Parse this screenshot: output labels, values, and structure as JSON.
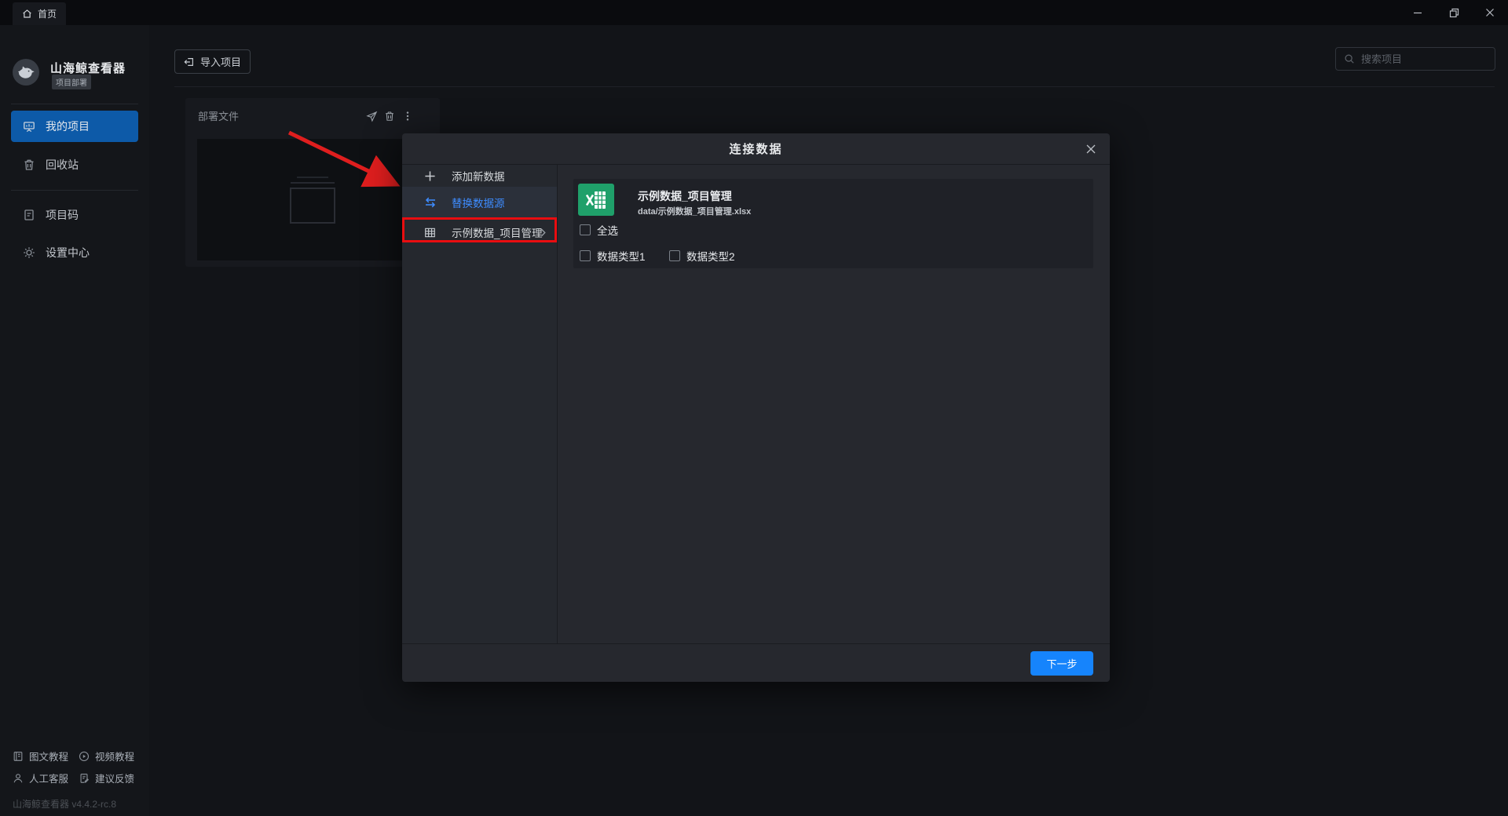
{
  "titlebar": {
    "tab_label": "首页"
  },
  "sidebar": {
    "app_name": "山海鲸查看器",
    "badge": "项目部署",
    "items": [
      {
        "label": "我的项目",
        "active": true
      },
      {
        "label": "回收站",
        "active": false
      },
      {
        "label": "项目码",
        "active": false
      },
      {
        "label": "设置中心",
        "active": false
      }
    ],
    "footer_links": [
      {
        "label": "图文教程"
      },
      {
        "label": "视频教程"
      },
      {
        "label": "人工客服"
      },
      {
        "label": "建议反馈"
      }
    ],
    "version": "山海鲸查看器 v4.4.2-rc.8"
  },
  "toolbar": {
    "import_label": "导入项目",
    "search_placeholder": "搜索项目"
  },
  "card": {
    "title": "部署文件"
  },
  "modal": {
    "title": "连接数据",
    "menu": [
      {
        "label": "添加新数据"
      },
      {
        "label": "替换数据源",
        "selected": true
      },
      {
        "label": "示例数据_项目管理"
      }
    ],
    "file": {
      "name": "示例数据_项目管理",
      "path": "data/示例数据_项目管理.xlsx"
    },
    "select_all_label": "全选",
    "type_labels": [
      "数据类型1",
      "数据类型2"
    ],
    "next_label": "下一步"
  },
  "colors": {
    "accent_button_blue": "#1684FC",
    "selected_nav_blue": "#0D5AA8",
    "link_blue": "#3E8CFF",
    "annotation_red": "#E90D10",
    "excel_green": "#1FA06A"
  }
}
